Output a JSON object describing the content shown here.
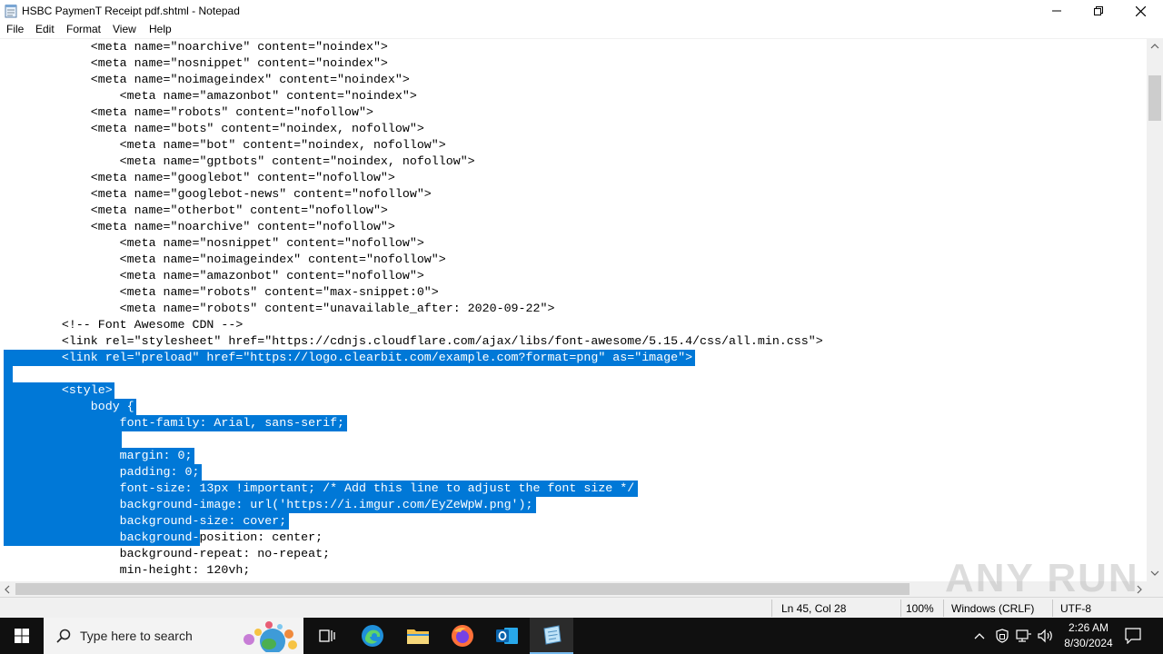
{
  "window": {
    "title": "HSBC PaymenT Receipt pdf.shtml - Notepad"
  },
  "menu": [
    "File",
    "Edit",
    "Format",
    "View",
    "Help"
  ],
  "editor": {
    "lines": [
      {
        "text": "            <meta name=\"noarchive\" content=\"noindex\">",
        "selected": false
      },
      {
        "text": "            <meta name=\"nosnippet\" content=\"noindex\">",
        "selected": false
      },
      {
        "text": "            <meta name=\"noimageindex\" content=\"noindex\">",
        "selected": false
      },
      {
        "text": "                <meta name=\"amazonbot\" content=\"noindex\">",
        "selected": false
      },
      {
        "text": "            <meta name=\"robots\" content=\"nofollow\">",
        "selected": false
      },
      {
        "text": "            <meta name=\"bots\" content=\"noindex, nofollow\">",
        "selected": false
      },
      {
        "text": "                <meta name=\"bot\" content=\"noindex, nofollow\">",
        "selected": false
      },
      {
        "text": "                <meta name=\"gptbots\" content=\"noindex, nofollow\">",
        "selected": false
      },
      {
        "text": "            <meta name=\"googlebot\" content=\"nofollow\">",
        "selected": false
      },
      {
        "text": "            <meta name=\"googlebot-news\" content=\"nofollow\">",
        "selected": false
      },
      {
        "text": "            <meta name=\"otherbot\" content=\"nofollow\">",
        "selected": false
      },
      {
        "text": "            <meta name=\"noarchive\" content=\"nofollow\">",
        "selected": false
      },
      {
        "text": "                <meta name=\"nosnippet\" content=\"nofollow\">",
        "selected": false
      },
      {
        "text": "                <meta name=\"noimageindex\" content=\"nofollow\">",
        "selected": false
      },
      {
        "text": "                <meta name=\"amazonbot\" content=\"nofollow\">",
        "selected": false
      },
      {
        "text": "                <meta name=\"robots\" content=\"max-snippet:0\">",
        "selected": false
      },
      {
        "text": "                <meta name=\"robots\" content=\"unavailable_after: 2020-09-22\">",
        "selected": false
      },
      {
        "text": "        <!-- Font Awesome CDN -->",
        "selected": false
      },
      {
        "text": "        <link rel=\"stylesheet\" href=\"https://cdnjs.cloudflare.com/ajax/libs/font-awesome/5.15.4/css/all.min.css\">",
        "selected": false
      },
      {
        "text": "        <link rel=\"preload\" href=\"https://logo.clearbit.com/example.com?format=png\" as=\"image\">",
        "selected": true
      },
      {
        "text": "",
        "selected": true
      },
      {
        "text": "        <style>",
        "selected": true
      },
      {
        "text": "            body {",
        "selected": true
      },
      {
        "text": "                font-family: Arial, sans-serif;",
        "selected": true
      },
      {
        "text": "                ",
        "selected": true
      },
      {
        "text": "                margin: 0;",
        "selected": true
      },
      {
        "text": "                padding: 0;",
        "selected": true
      },
      {
        "text": "                font-size: 13px !important; /* Add this line to adjust the font size */",
        "selected": true
      },
      {
        "text": "                background-image: url('https://i.imgur.com/EyZeWpW.png');",
        "selected": true
      },
      {
        "text": "                background-size: cover;",
        "selected": true
      },
      {
        "text": "                background-position: center;",
        "selected": "partial",
        "selected_part": "                background-",
        "rest_part": "position: center;"
      },
      {
        "text": "                background-repeat: no-repeat;",
        "selected": false
      },
      {
        "text": "                min-height: 120vh;",
        "selected": false
      }
    ]
  },
  "status": {
    "position": "Ln 45, Col 28",
    "zoom": "100%",
    "line_ending": "Windows (CRLF)",
    "encoding": "UTF-8"
  },
  "watermark": "ANY RUN",
  "taskbar": {
    "search_placeholder": "Type here to search",
    "time": "2:26 AM",
    "date": "8/30/2024"
  },
  "colors": {
    "selection": "#0078d7",
    "taskbar": "#101010"
  }
}
